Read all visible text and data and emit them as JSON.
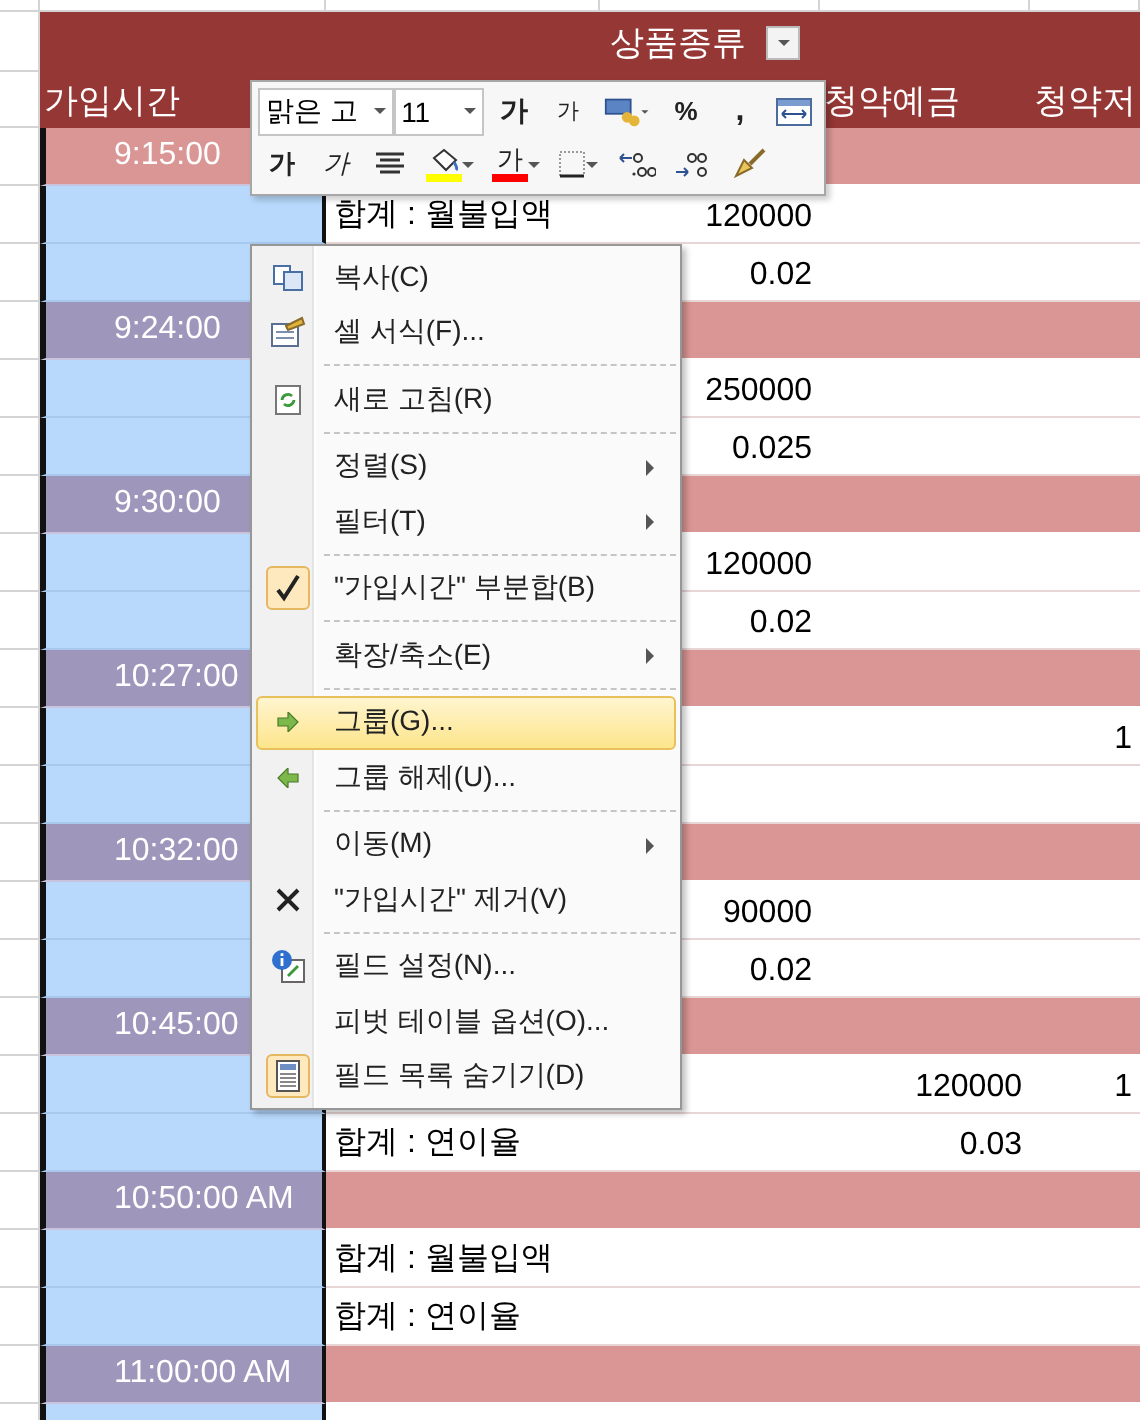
{
  "header": {
    "title": "상품종류",
    "row_field": "가입시간",
    "columns": [
      "청약예금",
      "청약저"
    ]
  },
  "rows": [
    {
      "kind": "group",
      "time": "9:15:00",
      "selected": true
    },
    {
      "kind": "data",
      "label": "합계 : 월불입액",
      "col_d": "120000",
      "selected": false
    },
    {
      "kind": "data",
      "col_d": "0.02",
      "selected": false
    },
    {
      "kind": "group",
      "time": "9:24:00",
      "selected": false
    },
    {
      "kind": "data",
      "col_d": "250000",
      "selected": false
    },
    {
      "kind": "data",
      "col_d": "0.025",
      "selected": false
    },
    {
      "kind": "group",
      "time": "9:30:00",
      "selected": false
    },
    {
      "kind": "data",
      "col_d": "120000",
      "selected": false
    },
    {
      "kind": "data",
      "col_d": "0.02",
      "selected": false
    },
    {
      "kind": "group",
      "time": "10:27:00",
      "selected": false
    },
    {
      "kind": "data",
      "col_f": "1",
      "selected": false
    },
    {
      "kind": "data",
      "selected": false
    },
    {
      "kind": "group",
      "time": "10:32:00",
      "selected": false
    },
    {
      "kind": "data",
      "col_d": "90000",
      "selected": false
    },
    {
      "kind": "data",
      "col_d": "0.02",
      "selected": false
    },
    {
      "kind": "group",
      "time": "10:45:00",
      "selected": false
    },
    {
      "kind": "data",
      "col_e": "120000",
      "col_f": "1",
      "selected": false
    },
    {
      "kind": "data",
      "label": "합계 : 연이율",
      "col_e": "0.03",
      "selected": false
    },
    {
      "kind": "group",
      "time": "10:50:00 AM",
      "selected": false
    },
    {
      "kind": "data",
      "label": "합계 : 월불입액",
      "selected": false
    },
    {
      "kind": "data",
      "label": "합계 : 연이율",
      "selected": false
    },
    {
      "kind": "group",
      "time": "11:00:00 AM",
      "selected": false
    }
  ],
  "mini_toolbar": {
    "font_controls": [
      {
        "kind": "font",
        "text": "맑은 고"
      },
      {
        "kind": "size",
        "text": "11"
      },
      {
        "kind": "grow",
        "text": "가"
      },
      {
        "kind": "shrink",
        "text": "가"
      },
      {
        "kind": "accounting"
      },
      {
        "kind": "percent",
        "text": "%"
      },
      {
        "kind": "comma",
        "text": ","
      },
      {
        "kind": "merge"
      }
    ],
    "format_controls": [
      {
        "kind": "bold",
        "text": "가"
      },
      {
        "kind": "italic",
        "text": "가"
      },
      {
        "kind": "center"
      },
      {
        "kind": "fill",
        "color": "#ffff00"
      },
      {
        "kind": "font-color",
        "text": "가",
        "color": "#ff0000"
      },
      {
        "kind": "border"
      },
      {
        "kind": "more-decimals"
      },
      {
        "kind": "fewer-decimals"
      },
      {
        "kind": "painter"
      }
    ]
  },
  "context_menu": [
    {
      "kind": "copy",
      "label": "복사(C)",
      "divider_above": false,
      "submenu": false,
      "checked": false,
      "selected": false
    },
    {
      "kind": "format",
      "label": "셀 서식(F)...",
      "divider_above": false,
      "submenu": false,
      "checked": false,
      "selected": false
    },
    {
      "kind": "refresh",
      "label": "새로 고침(R)",
      "divider_above": true,
      "submenu": false,
      "checked": false,
      "selected": false
    },
    {
      "kind": "plain",
      "label": "정렬(S)",
      "divider_above": true,
      "submenu": true,
      "checked": false,
      "selected": false
    },
    {
      "kind": "plain",
      "label": "필터(T)",
      "divider_above": false,
      "submenu": true,
      "checked": false,
      "selected": false
    },
    {
      "kind": "check",
      "label": "\"가입시간\" 부분합(B)",
      "divider_above": true,
      "submenu": false,
      "checked": true,
      "selected": false
    },
    {
      "kind": "plain",
      "label": "확장/축소(E)",
      "divider_above": true,
      "submenu": true,
      "checked": false,
      "selected": false
    },
    {
      "kind": "group",
      "label": "그룹(G)...",
      "divider_above": true,
      "submenu": false,
      "checked": false,
      "selected": true
    },
    {
      "kind": "ungroup",
      "label": "그룹 해제(U)...",
      "divider_above": false,
      "submenu": false,
      "checked": false,
      "selected": false
    },
    {
      "kind": "plain",
      "label": "이동(M)",
      "divider_above": true,
      "submenu": true,
      "checked": false,
      "selected": false
    },
    {
      "kind": "remove",
      "label": "\"가입시간\" 제거(V)",
      "divider_above": false,
      "submenu": false,
      "checked": false,
      "selected": false
    },
    {
      "kind": "settings",
      "label": "필드 설정(N)...",
      "divider_above": true,
      "submenu": false,
      "checked": false,
      "selected": false
    },
    {
      "kind": "plain",
      "label": "피벗 테이블 옵션(O)...",
      "divider_above": false,
      "submenu": false,
      "checked": false,
      "selected": false
    },
    {
      "kind": "fieldlist",
      "label": "필드 목록 숨기기(D)",
      "divider_above": false,
      "submenu": false,
      "checked": true,
      "selected": false
    }
  ]
}
